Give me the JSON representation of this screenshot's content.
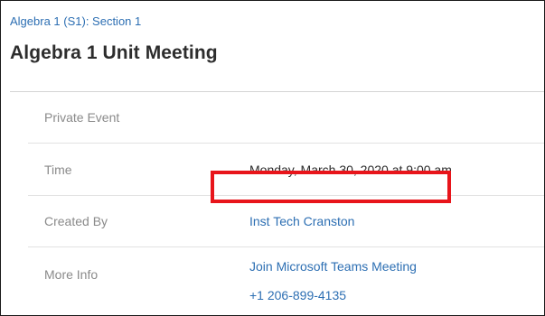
{
  "breadcrumb": "Algebra 1 (S1): Section 1",
  "title": "Algebra 1 Unit Meeting",
  "event_type": "Private Event",
  "rows": {
    "time": {
      "label": "Time",
      "value": "Monday, March 30, 2020 at 9:00 am"
    },
    "created_by": {
      "label": "Created By",
      "value": "Inst Tech Cranston"
    },
    "more_info": {
      "label": "More Info",
      "link": "Join Microsoft Teams Meeting",
      "phone": "+1 206-899-4135"
    }
  },
  "colors": {
    "link": "#2d6fb3",
    "highlight": "#e8151b"
  }
}
